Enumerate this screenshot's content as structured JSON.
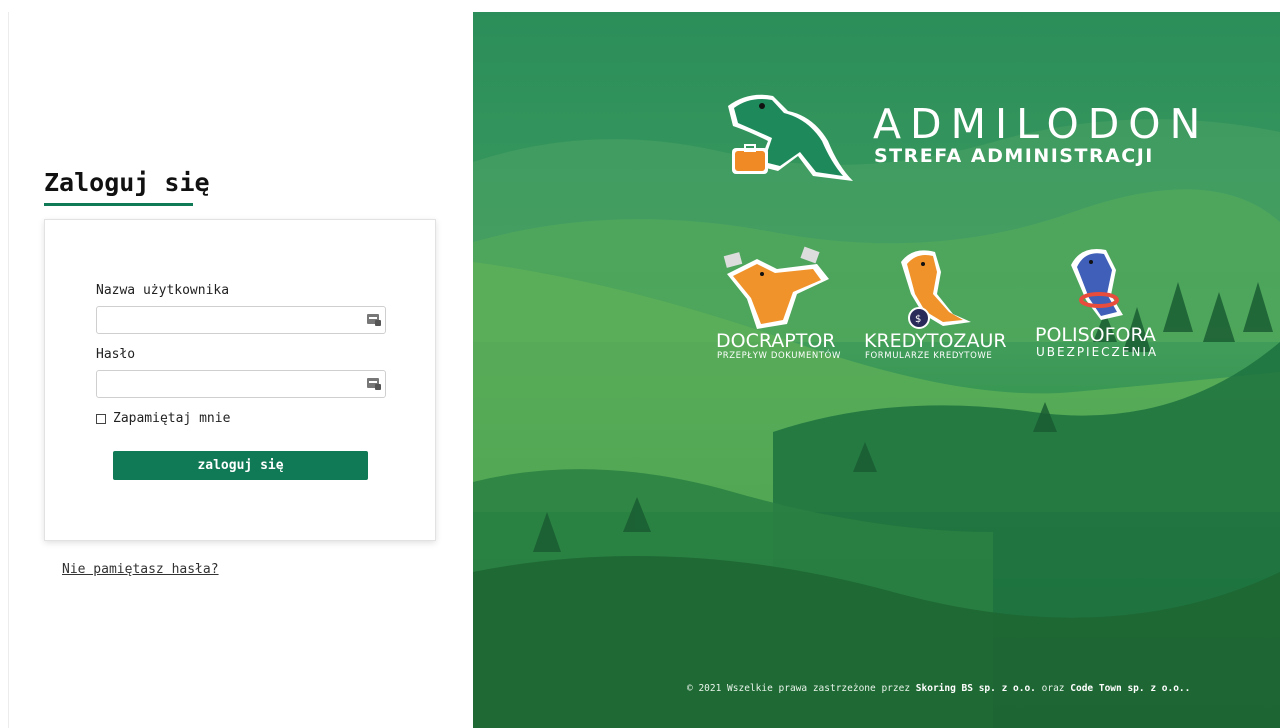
{
  "login": {
    "title": "Zaloguj się",
    "username_label": "Nazwa użytkownika",
    "username_value": "",
    "password_label": "Hasło",
    "password_value": "",
    "remember_label": "Zapamiętaj mnie",
    "remember_checked": false,
    "submit_label": "zaloguj się",
    "forgot_link": "Nie pamiętasz hasła?"
  },
  "brand": {
    "title": "ADMILODON",
    "subtitle": "STREFA ADMINISTRACJI"
  },
  "apps": [
    {
      "name": "DOCRAPTOR",
      "subtitle": "PRZEPŁYW DOKUMENTÓW",
      "logo": "docraptor-dinosaur-logo"
    },
    {
      "name": "KREDYTOZAUR",
      "subtitle": "FORMULARZE KREDYTOWE",
      "logo": "kredytozaur-dinosaur-logo"
    },
    {
      "name": "POLISOFORA",
      "subtitle": "UBEZPIECZENIA",
      "logo": "polisofora-dinosaur-logo"
    }
  ],
  "footer": {
    "prefix": "© 2021 Wszelkie prawa zastrzeżone przez",
    "company1": "Skoring BS sp. z o.o.",
    "conjunction": "oraz",
    "company2": "Code Town sp. z o.o.."
  },
  "colors": {
    "accent": "#0f7a55",
    "hero_green": "#3c9a5e"
  }
}
